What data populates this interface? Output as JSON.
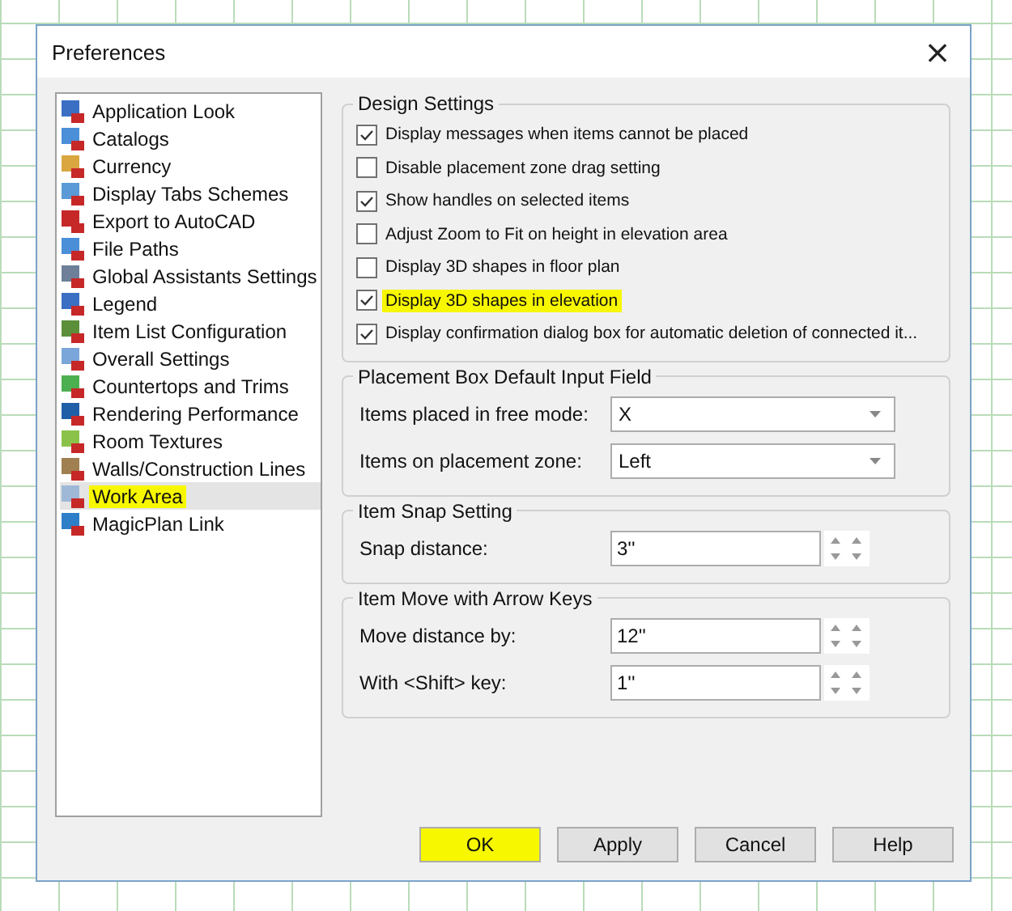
{
  "window": {
    "title": "Preferences",
    "close": "×"
  },
  "sidebar": {
    "items": [
      {
        "label": "Application Look",
        "selected": false,
        "highlighted": false,
        "color": "#3a6fc4"
      },
      {
        "label": "Catalogs",
        "selected": false,
        "highlighted": false,
        "color": "#4a8fd8"
      },
      {
        "label": "Currency",
        "selected": false,
        "highlighted": false,
        "color": "#d9a640"
      },
      {
        "label": "Display Tabs Schemes",
        "selected": false,
        "highlighted": false,
        "color": "#5a9ad6"
      },
      {
        "label": "Export to AutoCAD",
        "selected": false,
        "highlighted": false,
        "color": "#c62828"
      },
      {
        "label": "File Paths",
        "selected": false,
        "highlighted": false,
        "color": "#4a8fd8"
      },
      {
        "label": "Global Assistants Settings",
        "selected": false,
        "highlighted": false,
        "color": "#6d7f99"
      },
      {
        "label": "Legend",
        "selected": false,
        "highlighted": false,
        "color": "#3a6fc4"
      },
      {
        "label": "Item List Configuration",
        "selected": false,
        "highlighted": false,
        "color": "#5b8f3a"
      },
      {
        "label": "Overall Settings",
        "selected": false,
        "highlighted": false,
        "color": "#7aa6d9"
      },
      {
        "label": "Countertops and Trims",
        "selected": false,
        "highlighted": false,
        "color": "#4caf50"
      },
      {
        "label": "Rendering Performance",
        "selected": false,
        "highlighted": false,
        "color": "#1f5fa8"
      },
      {
        "label": "Room Textures",
        "selected": false,
        "highlighted": false,
        "color": "#8bc34a"
      },
      {
        "label": "Walls/Construction Lines",
        "selected": false,
        "highlighted": false,
        "color": "#a08050"
      },
      {
        "label": "Work Area",
        "selected": true,
        "highlighted": true,
        "color": "#9fb8d8"
      },
      {
        "label": "MagicPlan Link",
        "selected": false,
        "highlighted": false,
        "color": "#2f7fc8"
      }
    ]
  },
  "design_settings": {
    "title": "Design Settings",
    "options": [
      {
        "label": "Display messages when items cannot be placed",
        "checked": true,
        "highlighted": false
      },
      {
        "label": "Disable placement zone drag setting",
        "checked": false,
        "highlighted": false
      },
      {
        "label": "Show handles on selected items",
        "checked": true,
        "highlighted": false
      },
      {
        "label": "Adjust Zoom to Fit on height in elevation area",
        "checked": false,
        "highlighted": false
      },
      {
        "label": "Display 3D shapes in floor plan",
        "checked": false,
        "highlighted": false
      },
      {
        "label": "Display 3D shapes in elevation",
        "checked": true,
        "highlighted": true
      },
      {
        "label": "Display confirmation dialog box for automatic deletion of connected it...",
        "checked": true,
        "highlighted": false
      }
    ]
  },
  "placement_box": {
    "title": "Placement Box Default Input Field",
    "fields": [
      {
        "label": "Items placed in free mode:",
        "value": "X"
      },
      {
        "label": "Items on placement zone:",
        "value": "Left"
      }
    ]
  },
  "item_snap": {
    "title": "Item Snap Setting",
    "fields": [
      {
        "label": "Snap distance:",
        "value": "3''"
      }
    ]
  },
  "item_move": {
    "title": "Item Move with Arrow Keys",
    "fields": [
      {
        "label": "Move distance by:",
        "value": "12''"
      },
      {
        "label": "With <Shift> key:",
        "value": "1''"
      }
    ]
  },
  "buttons": [
    {
      "label": "OK",
      "highlighted": true
    },
    {
      "label": "Apply",
      "highlighted": false
    },
    {
      "label": "Cancel",
      "highlighted": false
    },
    {
      "label": "Help",
      "highlighted": false
    }
  ]
}
